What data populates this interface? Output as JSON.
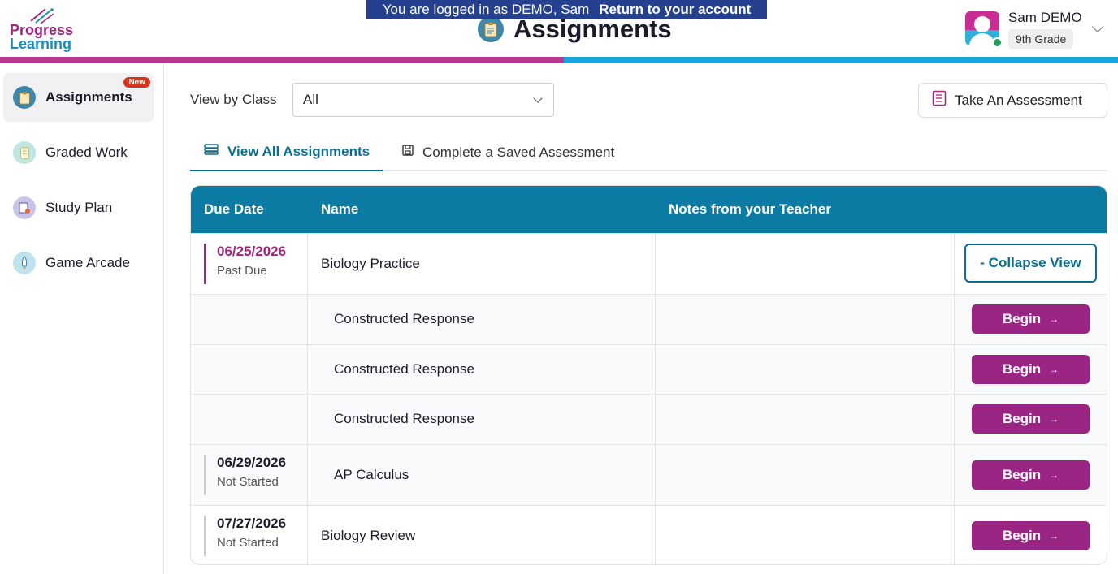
{
  "banner": {
    "logged_in_text": "You are logged in as DEMO, Sam",
    "return_link": "Return to your account"
  },
  "brand": {
    "line1": "Progress",
    "line2": "Learning",
    "colors": {
      "pink": "#a3237f",
      "blue": "#1a8fbf",
      "primary_button": "#9b2582",
      "table_header": "#0b7ba3"
    }
  },
  "header": {
    "title": "Assignments",
    "title_icon": "clipboard-icon"
  },
  "user": {
    "name": "Sam DEMO",
    "grade": "9th Grade"
  },
  "sidebar": {
    "items": [
      {
        "label": "Assignments",
        "icon": "clipboard-icon",
        "badge": "New",
        "active": true
      },
      {
        "label": "Graded Work",
        "icon": "graded-paper-icon"
      },
      {
        "label": "Study Plan",
        "icon": "study-plan-icon"
      },
      {
        "label": "Game Arcade",
        "icon": "rocket-icon"
      }
    ]
  },
  "filters": {
    "view_by_label": "View by Class",
    "class_selected": "All",
    "take_assessment_label": "Take An Assessment"
  },
  "tabs": [
    {
      "label": "View All Assignments",
      "icon": "stack-icon",
      "active": true
    },
    {
      "label": "Complete a Saved Assessment",
      "icon": "save-icon"
    }
  ],
  "table": {
    "headers": {
      "due_date": "Due Date",
      "name": "Name",
      "notes": "Notes from your Teacher"
    },
    "rows": [
      {
        "date": "06/25/2026",
        "status": "Past Due",
        "name": "Biology Practice",
        "notes": "",
        "action": "- Collapse View"
      },
      {
        "name": "Constructed Response",
        "action": "Begin"
      },
      {
        "name": "Constructed Response",
        "action": "Begin"
      },
      {
        "name": "Constructed Response",
        "action": "Begin"
      },
      {
        "date": "06/29/2026",
        "status": "Not Started",
        "name": "AP Calculus",
        "notes": "",
        "action": "Begin"
      },
      {
        "date": "07/27/2026",
        "status": "Not Started",
        "name": "Biology Review",
        "notes": "",
        "action": "Begin"
      }
    ],
    "begin_arrow": "→"
  }
}
